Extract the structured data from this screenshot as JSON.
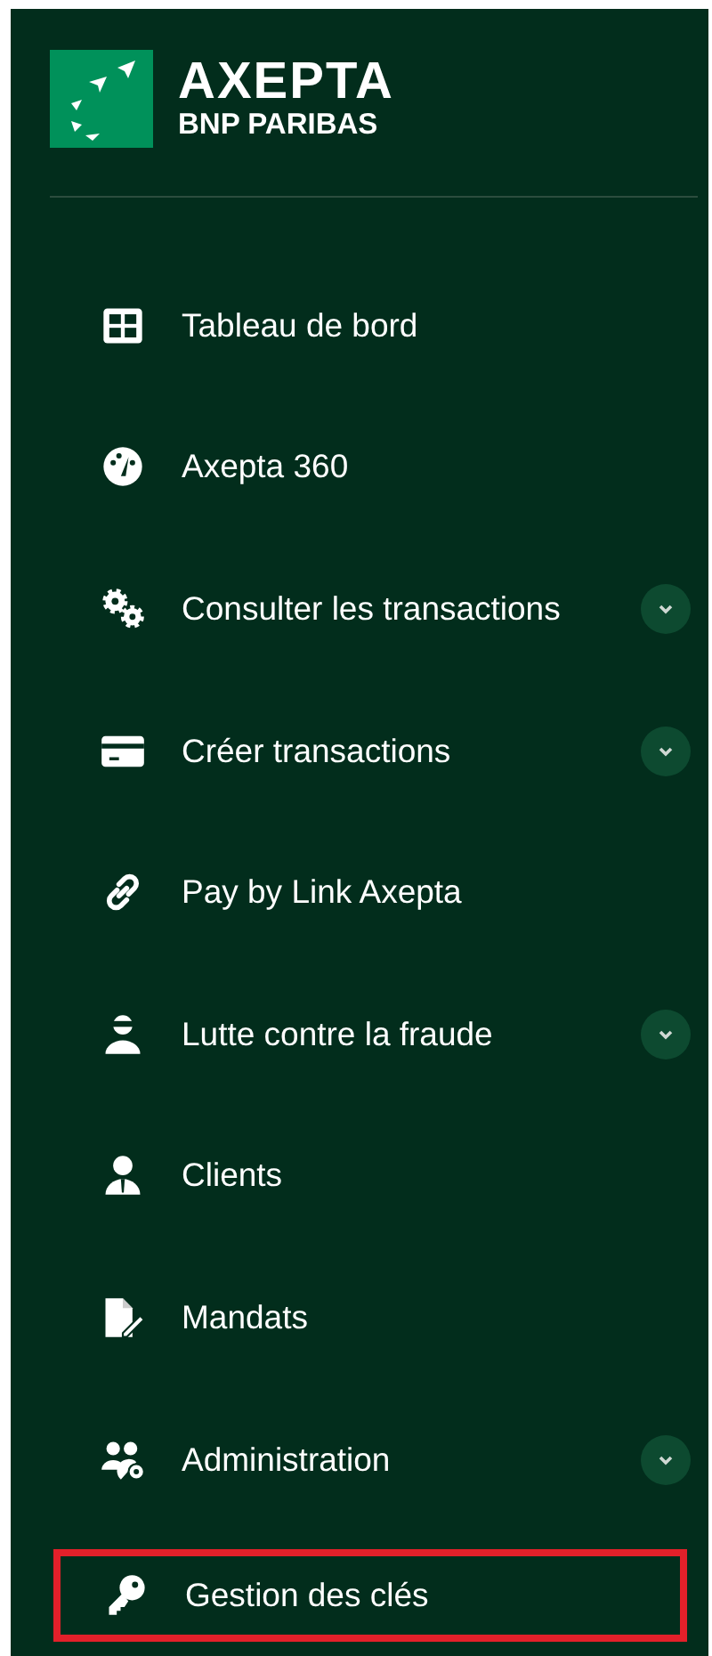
{
  "brand": {
    "name": "AXEPTA",
    "sub": "BNP PARIBAS"
  },
  "menu": [
    {
      "label": "Tableau de bord",
      "kind": "grid",
      "expandable": false,
      "highlighted": false
    },
    {
      "label": "Axepta 360",
      "kind": "gauge",
      "expandable": false,
      "highlighted": false
    },
    {
      "label": "Consulter les transactions",
      "kind": "gears",
      "expandable": true,
      "highlighted": false
    },
    {
      "label": "Créer transactions",
      "kind": "card",
      "expandable": true,
      "highlighted": false
    },
    {
      "label": "Pay by Link Axepta",
      "kind": "link",
      "expandable": false,
      "highlighted": false
    },
    {
      "label": "Lutte contre la fraude",
      "kind": "fraud",
      "expandable": true,
      "highlighted": false
    },
    {
      "label": "Clients",
      "kind": "client",
      "expandable": false,
      "highlighted": false
    },
    {
      "label": "Mandats",
      "kind": "document",
      "expandable": false,
      "highlighted": false
    },
    {
      "label": "Administration",
      "kind": "users",
      "expandable": true,
      "highlighted": false
    },
    {
      "label": "Gestion des clés",
      "kind": "key",
      "expandable": false,
      "highlighted": true
    }
  ]
}
